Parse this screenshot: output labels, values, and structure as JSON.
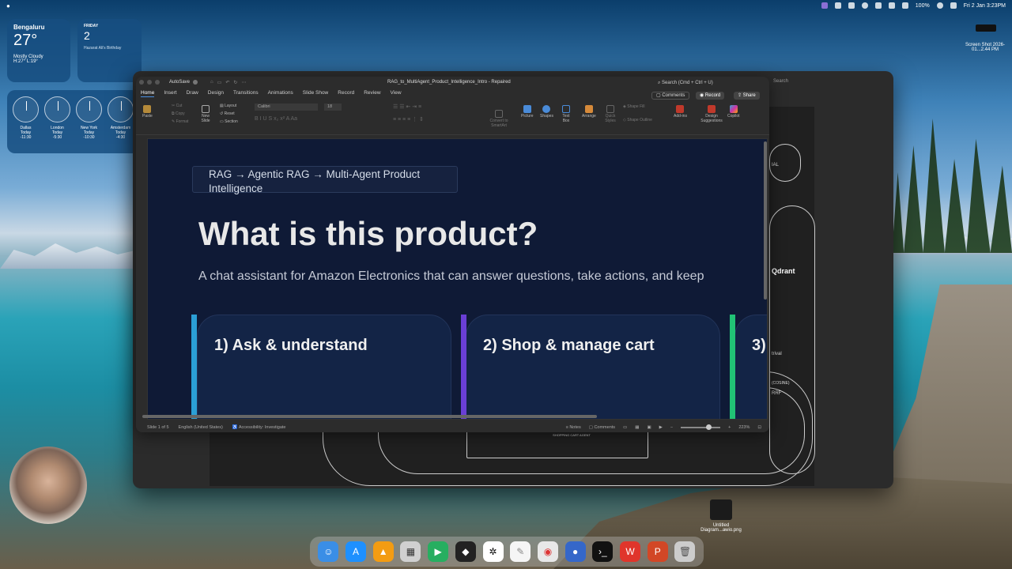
{
  "menubar": {
    "datetime": "Fri 2 Jan  3:23PM",
    "battery": "100%"
  },
  "widgets": {
    "weather": {
      "city": "Bengaluru",
      "temp": "27°",
      "condition": "Mostly Cloudy",
      "hilo": "H:27° L:19°"
    },
    "calendar": {
      "day": "FRIDAY",
      "date": "2",
      "event": "Hazarat Ali's Birthday"
    },
    "clocks": [
      {
        "city": "Dallas",
        "day": "Today",
        "offset": "-11:30"
      },
      {
        "city": "London",
        "day": "Today",
        "offset": "-5:30"
      },
      {
        "city": "New York",
        "day": "Today",
        "offset": "-10:30"
      },
      {
        "city": "Amsterdam",
        "day": "Today",
        "offset": "-4:30"
      }
    ]
  },
  "desktop": {
    "screenshot_label": "Screen Shot 2026-01...2.44 PM",
    "file_label": "Untitled Diagram...awio.png"
  },
  "background_window": {
    "search": "Search",
    "labels": [
      "IAL",
      "Qdrant",
      "trival",
      "RRF",
      "(COSINE)"
    ],
    "agent_label": "SHOPPING CART AGENT"
  },
  "ppt": {
    "autosave": "AutoSave",
    "title": "RAG_to_MultiAgent_Product_Intelligence_Intro  -  Repaired",
    "search_placeholder": "Search (Cmd + Ctrl + U)",
    "tabs": [
      "Home",
      "Insert",
      "Draw",
      "Design",
      "Transitions",
      "Animations",
      "Slide Show",
      "Record",
      "Review",
      "View"
    ],
    "buttons": {
      "comments": "Comments",
      "record": "Record",
      "share": "Share"
    },
    "ribbon": {
      "paste": "Paste",
      "cut": "Cut",
      "copy": "Copy",
      "format": "Format",
      "new_slide": "New Slide",
      "layout": "Layout",
      "reset": "Reset",
      "section": "Section",
      "font_name": "Calibri",
      "font_size": "18",
      "convert_smartart": "Convert to SmartArt",
      "picture": "Picture",
      "shapes": "Shapes",
      "text_box": "Text Box",
      "arrange": "Arrange",
      "quick_styles": "Quick Styles",
      "shape_fill": "Shape Fill",
      "shape_outline": "Shape Outline",
      "addins": "Add-ins",
      "design_suggestions": "Design Suggestions",
      "copilot": "Copilot"
    },
    "slide": {
      "breadcrumb": "RAG → Agentic RAG → Multi-Agent Product Intelligence",
      "title": "What is this product?",
      "subtitle": "A chat assistant for Amazon Electronics that can answer questions, take actions, and keep",
      "cards": [
        {
          "title": "1) Ask & understand",
          "color": "#2b9fd6"
        },
        {
          "title": "2) Shop & manage cart",
          "color": "#6a3fd6"
        },
        {
          "title": "3)",
          "color": "#21c275"
        }
      ]
    },
    "status": {
      "slide": "Slide 1 of 5",
      "language": "English (United States)",
      "accessibility": "Accessibility: Investigate",
      "notes": "Notes",
      "comments": "Comments",
      "zoom": "223%"
    }
  }
}
